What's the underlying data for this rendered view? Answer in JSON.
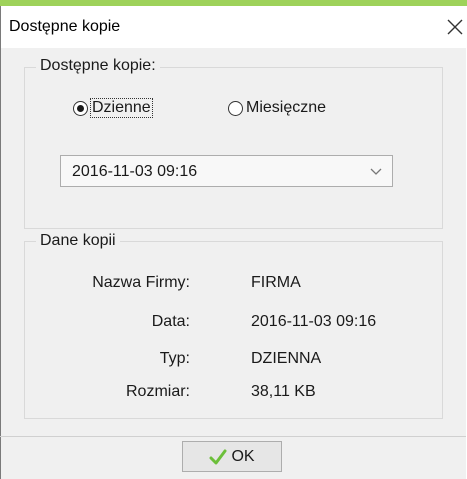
{
  "window": {
    "title": "Dostępne kopie",
    "accent_color": "#9ed25a",
    "close_icon": "close-icon"
  },
  "available_copies": {
    "group_label": "Dostępne kopie:",
    "options": [
      {
        "label": "Dzienne",
        "selected": true
      },
      {
        "label": "Miesięczne",
        "selected": false
      }
    ],
    "selected_copy": "2016-11-03 09:16"
  },
  "copy_details": {
    "group_label": "Dane kopii",
    "rows": [
      {
        "label": "Nazwa Firmy:",
        "value": "FIRMA"
      },
      {
        "label": "Data:",
        "value": "2016-11-03 09:16"
      },
      {
        "label": "Typ:",
        "value": "DZIENNA"
      },
      {
        "label": "Rozmiar:",
        "value": "38,11 KB"
      }
    ]
  },
  "footer": {
    "ok_label": "OK",
    "ok_icon": "check-icon",
    "ok_icon_color": "#6cbf3a"
  }
}
